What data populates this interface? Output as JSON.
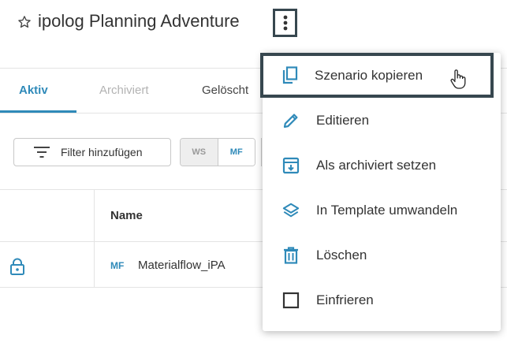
{
  "header": {
    "title": "ipolog Planning Adventure",
    "favorite_icon": "star-outline-icon",
    "more_icon": "more-vertical-icon"
  },
  "tabs": [
    {
      "label": "Aktiv",
      "state": "active"
    },
    {
      "label": "Archiviert",
      "state": "disabled"
    },
    {
      "label": "Gelöscht",
      "state": "normal"
    }
  ],
  "toolbar": {
    "filter_label": "Filter hinzufügen",
    "toggle_ws": "WS",
    "toggle_mf": "MF"
  },
  "table": {
    "columns": [
      "Name"
    ],
    "rows": [
      {
        "type": "MF",
        "name": "Materialflow_iPA",
        "status_icon": "lock-icon"
      }
    ]
  },
  "menu": {
    "items": [
      {
        "label": "Szenario kopieren",
        "icon": "copy-icon",
        "highlighted": true
      },
      {
        "label": "Editieren",
        "icon": "pencil-icon"
      },
      {
        "label": "Als archiviert setzen",
        "icon": "archive-icon"
      },
      {
        "label": "In Template umwandeln",
        "icon": "layers-icon"
      },
      {
        "label": "Löschen",
        "icon": "trash-icon"
      },
      {
        "label": "Einfrieren",
        "icon": "checkbox-outline-icon"
      }
    ]
  },
  "colors": {
    "accent": "#2f8ab9",
    "highlight_border": "#37474f",
    "text": "#333333",
    "muted": "#b3b3b3"
  }
}
